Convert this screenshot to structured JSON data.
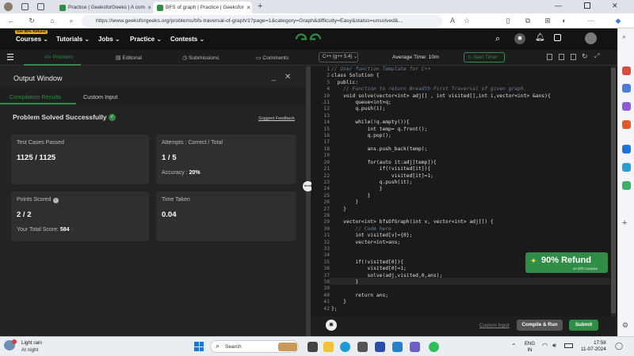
{
  "browser": {
    "tabs": [
      {
        "label": "Practice | GeeksforGeeks | A com"
      },
      {
        "label": "BFS of graph | Practice | Geeksfor"
      }
    ],
    "url": "https://www.geeksforgeeks.org/problems/bfs-traversal-of-graph/1?page=1&category=Graph&difficulty=Easy&status=unsolved&..."
  },
  "header": {
    "promo_badge": "Get 90% Refund",
    "nav": [
      "Courses",
      "Tutorials",
      "Jobs",
      "Practice",
      "Contests"
    ]
  },
  "subnav": {
    "tabs": [
      "Problem",
      "Editorial",
      "Submissions",
      "Comments"
    ],
    "language": "C++ (g++ 5.4)",
    "avg_time": "Average Time: 10m",
    "start_timer": "Start Timer"
  },
  "output": {
    "title": "Output Window",
    "tabs": [
      "Compilation Results",
      "Custom Input"
    ],
    "status": "Problem Solved Successfully",
    "suggest_feedback": "Suggest Feedback",
    "test_cases_label": "Test Cases Passed",
    "test_cases_value": "1125 / 1125",
    "attempts_label": "Attempts : Correct / Total",
    "attempts_value": "1 / 5",
    "accuracy_label": "Accuracy :",
    "accuracy_value": "20%",
    "points_label": "Points Scored",
    "points_value": "2 / 2",
    "total_score_label": "Your Total Score:",
    "total_score_value": "584",
    "time_label": "Time Taken",
    "time_value": "0.04"
  },
  "editor": {
    "line_numbers": [
      "1",
      "2",
      "3",
      "4",
      "10",
      "11",
      "12",
      "13",
      "14",
      "15",
      "16",
      "17",
      "18",
      "19",
      "20",
      "21",
      "22",
      "23",
      "24",
      "25",
      "26",
      "27",
      "28",
      "29",
      "30",
      "31",
      "32",
      "33",
      "34",
      "35",
      "36",
      "37",
      "38",
      "39",
      "40",
      "41",
      "42"
    ],
    "code": [
      "// User function Template for C++",
      "class Solution {",
      "  public:",
      "    // Function to return Breadth First Traversal of given graph.",
      "    void solve(vector<int> adj[] , int visited[],int i,vector<int> &ans){",
      "        queue<int>q;",
      "        q.push(i);",
      "",
      "        while(!q.empty()){",
      "            int temp= q.front();",
      "            q.pop();",
      "",
      "            ans.push_back(temp);",
      "",
      "            for(auto it:adj[temp]){",
      "                if(!visited[it]){",
      "                    visited[it]=1;",
      "                q.push(it);",
      "                }",
      "            }",
      "        }",
      "    }",
      "",
      "    vector<int> bfsOfGraph(int v, vector<int> adj[]) {",
      "        // Code here",
      "        int visited[v]={0};",
      "        vector<int>ans;",
      "",
      "",
      "        if(!visited[0]){",
      "            visited[0]=1;",
      "            solve(adj,visited,0,ans);",
      "        }",
      "",
      "        return ans;",
      "    }",
      "};"
    ],
    "refund_banner": "90% Refund",
    "refund_sub": "on GfG Courses",
    "custom_input": "Custom Input",
    "compile_run": "Compile & Run",
    "submit": "Submit"
  },
  "taskbar": {
    "weather_title": "Light rain",
    "weather_sub": "At night",
    "search_placeholder": "Search",
    "lang_top": "ENG",
    "lang_bottom": "IN",
    "time": "17:58",
    "date": "11-07-2024"
  },
  "colors": {
    "accent_green": "#2f8d46",
    "submit_green": "#2f8d46",
    "header_bg": "#131313"
  }
}
